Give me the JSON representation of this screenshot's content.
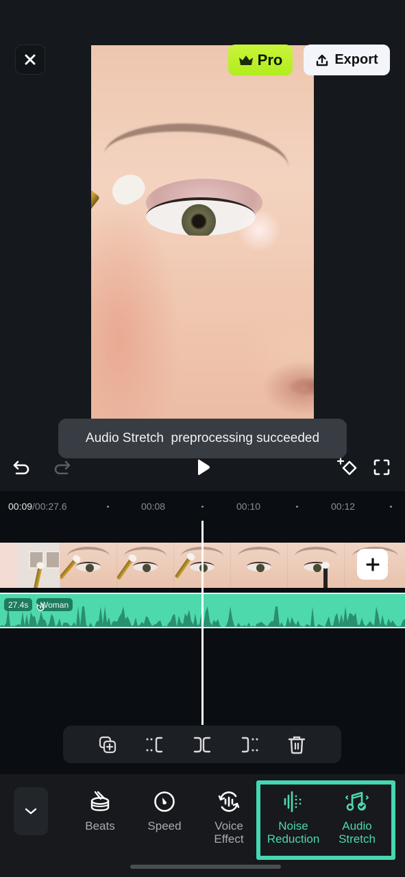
{
  "header": {
    "close_icon": "close-icon",
    "pro_label": "Pro",
    "pro_icon": "crown-icon",
    "export_label": "Export",
    "export_icon": "upload-icon"
  },
  "toast": {
    "message": "Audio Stretch  preprocessing succeeded"
  },
  "playback": {
    "undo_icon": "undo-icon",
    "redo_icon": "redo-icon",
    "play_icon": "play-icon",
    "keyframe_icon": "add-keyframe-icon",
    "fullscreen_icon": "fullscreen-icon"
  },
  "timeline": {
    "current_time": "00:09",
    "total_time": "/00:27.6",
    "ruler_ticks": [
      "00:08",
      "00:10",
      "00:12"
    ],
    "add_clip_icon": "plus-icon",
    "audio": {
      "duration_badge": "27.4s",
      "voice_effect_badge": "Woman",
      "color": "#4ed9ad"
    }
  },
  "edit_toolbar": [
    {
      "name": "duplicate",
      "icon": "duplicate-icon"
    },
    {
      "name": "trim-start",
      "icon": "trim-left-icon"
    },
    {
      "name": "split",
      "icon": "split-icon"
    },
    {
      "name": "trim-end",
      "icon": "trim-right-icon"
    },
    {
      "name": "delete",
      "icon": "trash-icon"
    }
  ],
  "bottom_tools": {
    "collapse_icon": "chevron-down-icon",
    "items": [
      {
        "label": "Beats",
        "icon": "drum-icon"
      },
      {
        "label": "Speed",
        "icon": "speedometer-icon"
      },
      {
        "label": "Voice\nEffect",
        "icon": "voice-effect-icon"
      },
      {
        "label": "Noise\nReduction",
        "icon": "noise-reduction-icon"
      },
      {
        "label": "Audio\nStretch",
        "icon": "audio-stretch-icon"
      }
    ],
    "accent_color": "#4ed9ad"
  }
}
